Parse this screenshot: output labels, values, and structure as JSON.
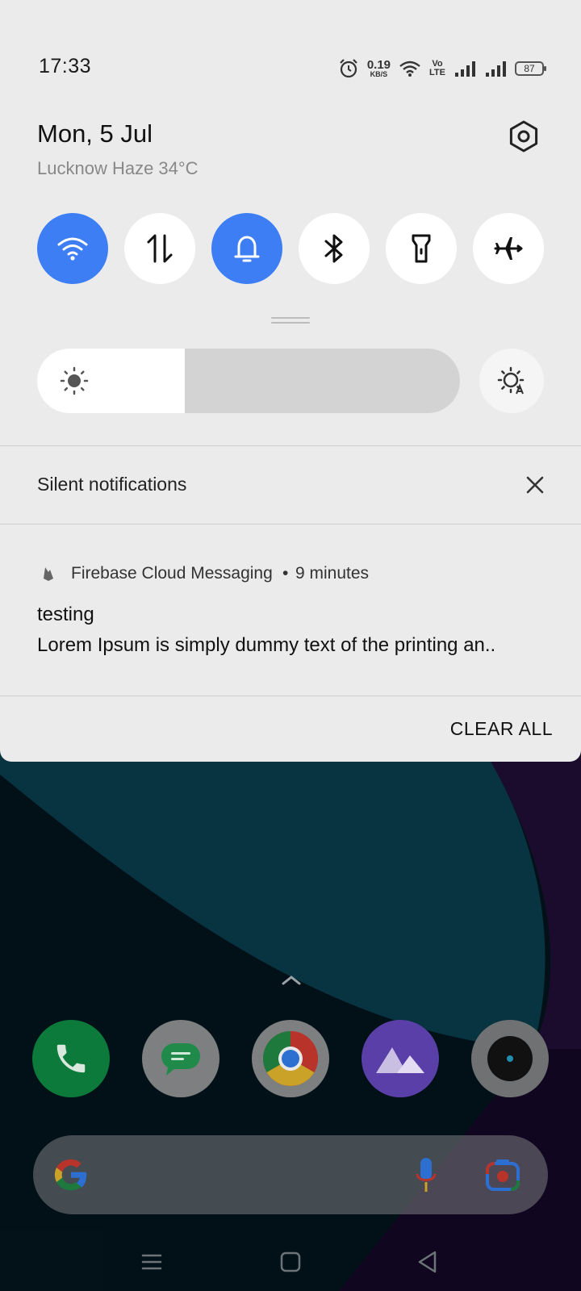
{
  "status_bar": {
    "time": "17:33",
    "net_speed": "0.19",
    "net_unit": "KB/S",
    "volte_top": "Vo",
    "volte_bottom": "LTE",
    "battery": "87",
    "icons": [
      "alarm-icon",
      "wifi-icon",
      "volte-icon",
      "signal-icon",
      "signal-icon",
      "battery-icon"
    ]
  },
  "header": {
    "date": "Mon, 5 Jul",
    "weather": "Lucknow Haze 34°C",
    "settings_icon": "gear-icon"
  },
  "quick_settings": {
    "tiles": [
      {
        "icon": "wifi-icon",
        "active": true
      },
      {
        "icon": "mobile-data-icon",
        "active": false
      },
      {
        "icon": "bell-icon",
        "active": true
      },
      {
        "icon": "bluetooth-icon",
        "active": false
      },
      {
        "icon": "flashlight-icon",
        "active": false
      },
      {
        "icon": "airplane-icon",
        "active": false
      }
    ],
    "active_color": "#3d7ef5",
    "brightness_level": 0.35
  },
  "notifications": {
    "section_title": "Silent notifications",
    "items": [
      {
        "app": "Firebase Cloud Messaging",
        "separator": "•",
        "time": "9 minutes",
        "title": "testing",
        "body": "Lorem Ipsum is simply dummy text of the printing an.."
      }
    ],
    "clear_all": "CLEAR ALL"
  },
  "home": {
    "dock": [
      "phone-icon",
      "messages-icon",
      "chrome-icon",
      "gallery-icon",
      "camera-icon"
    ],
    "search_icons": [
      "google-g-icon",
      "mic-icon",
      "lens-icon"
    ],
    "nav": [
      "menu-icon",
      "home-icon",
      "back-icon"
    ]
  }
}
